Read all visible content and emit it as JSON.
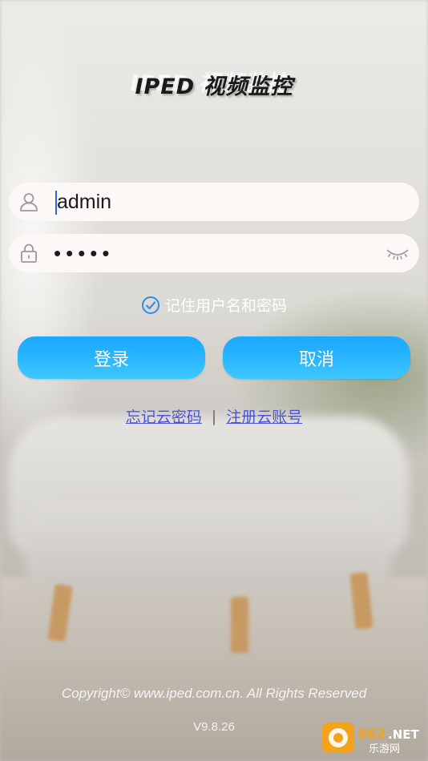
{
  "app": {
    "title": "IPED 视频监控"
  },
  "login_form": {
    "username": {
      "value": "admin",
      "icon": "user-icon"
    },
    "password": {
      "value": "•••••",
      "icon": "lock-icon",
      "toggle_icon": "eye-closed-icon"
    },
    "remember": {
      "label": "记住用户名和密码",
      "checked": true,
      "icon": "check-circle-icon"
    },
    "login_label": "登录",
    "cancel_label": "取消"
  },
  "links": {
    "forgot": "忘记云密码",
    "separator": "|",
    "register": "注册云账号"
  },
  "footer": {
    "copyright": "Copyright© www.iped.com.cn. All Rights Reserved",
    "version": "V9.8.26"
  },
  "watermark": {
    "text": "962.NET",
    "subtext": "乐游网"
  },
  "colors": {
    "accent": "#27b3ff",
    "link": "#4a53d8",
    "check": "#2f8ef0"
  }
}
